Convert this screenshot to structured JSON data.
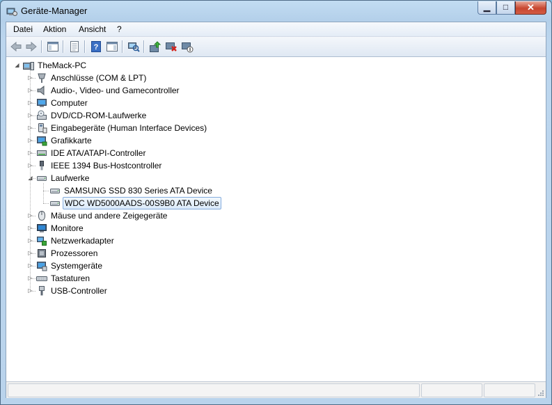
{
  "window": {
    "title": "Geräte-Manager"
  },
  "menu": [
    "Datei",
    "Aktion",
    "Ansicht",
    "?"
  ],
  "toolbar": [
    {
      "name": "back-button",
      "icon": "arrow-left-icon"
    },
    {
      "name": "forward-button",
      "icon": "arrow-right-icon"
    },
    {
      "name": "show-hide-console-tree-button",
      "icon": "console-tree-icon"
    },
    {
      "name": "properties-button",
      "icon": "properties-icon"
    },
    {
      "name": "help-button",
      "icon": "help-icon"
    },
    {
      "name": "show-action-pane-button",
      "icon": "action-pane-icon"
    },
    {
      "name": "scan-hardware-button",
      "icon": "scan-hardware-icon"
    },
    {
      "name": "update-driver-button",
      "icon": "update-driver-icon"
    },
    {
      "name": "uninstall-button",
      "icon": "uninstall-icon"
    },
    {
      "name": "disable-device-button",
      "icon": "disable-device-icon"
    }
  ],
  "tree": {
    "root": "TheMack-PC",
    "categories": [
      {
        "label": "Anschlüsse (COM & LPT)",
        "icon": "port-icon"
      },
      {
        "label": "Audio-, Video- und Gamecontroller",
        "icon": "speaker-icon"
      },
      {
        "label": "Computer",
        "icon": "computer-icon"
      },
      {
        "label": "DVD/CD-ROM-Laufwerke",
        "icon": "optical-drive-icon"
      },
      {
        "label": "Eingabegeräte (Human Interface Devices)",
        "icon": "hid-icon"
      },
      {
        "label": "Grafikkarte",
        "icon": "display-adapter-icon"
      },
      {
        "label": "IDE ATA/ATAPI-Controller",
        "icon": "ide-controller-icon"
      },
      {
        "label": "IEEE 1394 Bus-Hostcontroller",
        "icon": "firewire-icon"
      },
      {
        "label": "Laufwerke",
        "icon": "disk-drive-icon",
        "expanded": true,
        "children": [
          {
            "label": "SAMSUNG SSD 830 Series ATA Device",
            "icon": "disk-drive-icon"
          },
          {
            "label": "WDC WD5000AADS-00S9B0 ATA Device",
            "icon": "disk-drive-icon",
            "selected": true
          }
        ]
      },
      {
        "label": "Mäuse und andere Zeigegeräte",
        "icon": "mouse-icon"
      },
      {
        "label": "Monitore",
        "icon": "monitor-icon"
      },
      {
        "label": "Netzwerkadapter",
        "icon": "network-adapter-icon"
      },
      {
        "label": "Prozessoren",
        "icon": "processor-icon"
      },
      {
        "label": "Systemgeräte",
        "icon": "system-device-icon"
      },
      {
        "label": "Tastaturen",
        "icon": "keyboard-icon"
      },
      {
        "label": "USB-Controller",
        "icon": "usb-icon"
      }
    ]
  }
}
